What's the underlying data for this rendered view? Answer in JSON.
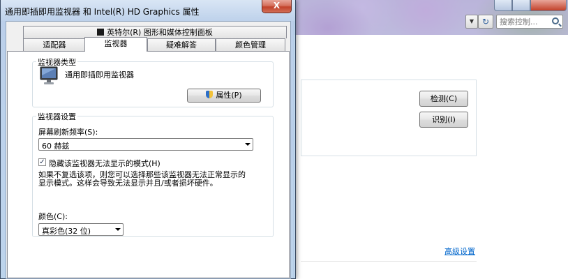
{
  "background_window": {
    "search_placeholder": "搜索控制...",
    "detect_button": "检测(C)",
    "identify_button": "识别(I)",
    "advanced_link": "高级设置",
    "refresh_glyph": "↻",
    "dropdown_glyph": "▼"
  },
  "dialog": {
    "title": "通用即插即用监视器 和 Intel(R) HD Graphics 属性",
    "close_label": "X",
    "tabs_row1": [
      {
        "label": "英特尔(R) 图形和媒体控制面板"
      }
    ],
    "tabs_row2": [
      {
        "label": "适配器"
      },
      {
        "label": "监视器",
        "active": true
      },
      {
        "label": "疑难解答"
      },
      {
        "label": "颜色管理"
      }
    ],
    "monitor_type": {
      "legend": "监视器类型",
      "name": "通用即插即用监视器",
      "properties_button": "属性(P)"
    },
    "monitor_settings": {
      "legend": "监视器设置",
      "refresh_label": "屏幕刷新频率(S):",
      "refresh_value": "60 赫兹",
      "hide_modes_label": "隐藏该监视器无法显示的模式(H)",
      "hide_modes_checked": true,
      "check_glyph": "✓",
      "warning_line1": "如果不复选该项，则您可以选择那些该监视器无法正常显示的",
      "warning_line2": "显示模式。这样会导致无法显示并且/或者损坏硬件。"
    },
    "colors": {
      "label": "颜色(C):",
      "value": "真彩色(32 位)"
    }
  }
}
